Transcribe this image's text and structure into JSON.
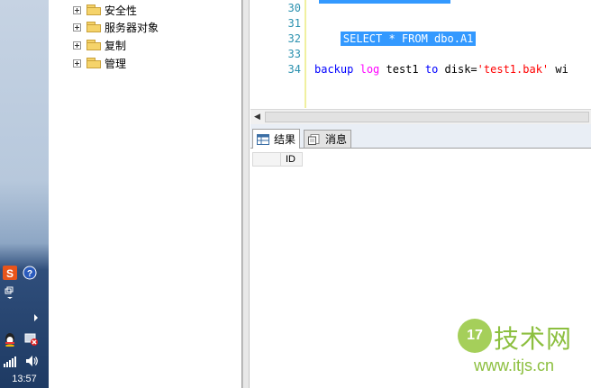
{
  "taskbar": {
    "time": "13:57"
  },
  "explorer": {
    "items": [
      {
        "label": "安全性"
      },
      {
        "label": "服务器对象"
      },
      {
        "label": "复制"
      },
      {
        "label": "管理"
      }
    ]
  },
  "editor": {
    "line_numbers": [
      "30",
      "31",
      "32",
      "33",
      "34"
    ],
    "line31": "SELECT * FROM dbo.A1",
    "line34": {
      "kw1": "backup",
      "fn1": "log",
      "t1": " test1 ",
      "kw2": "to",
      "t2": " disk=",
      "str1": "'test1.bak'",
      "t3": " wi"
    }
  },
  "results": {
    "tabs": [
      {
        "label": "结果"
      },
      {
        "label": "消息"
      }
    ],
    "columns": [
      "ID"
    ]
  },
  "watermark": {
    "logo": "17",
    "title": "技术网",
    "url": "www.itjs.cn"
  },
  "colors": {
    "selection": "#3399ff",
    "keyword": "#0000ff",
    "function": "#ff00ff",
    "string": "#ff0000",
    "line_number": "#2b91af"
  }
}
